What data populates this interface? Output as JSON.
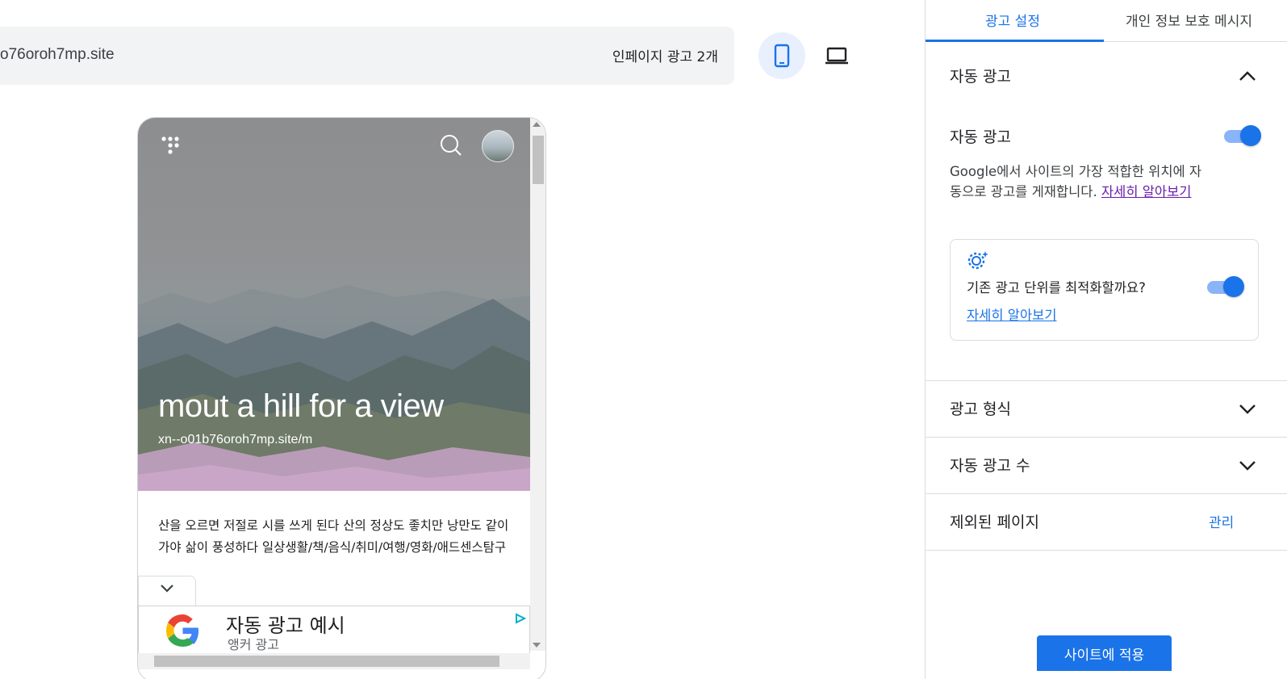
{
  "preview": {
    "url": "o76oroh7mp.site",
    "ad_count_label": "인페이지 광고 2개",
    "device_mobile_icon": "smartphone-icon",
    "device_desktop_icon": "laptop-icon"
  },
  "site": {
    "title": "mout a hill for a view",
    "subtitle": "xn--o01b76oroh7mp.site/m",
    "description": "산을 오르면 저절로 시를 쓰게 된다 산의 정상도 좋치만 낭만도 같이가야 삶이 풍성하다 일상생활/책/음식/취미/여행/영화/애드센스탐구",
    "menu_icon": "dots-menu-icon",
    "search_icon": "search-icon"
  },
  "anchor_ad": {
    "title": "자동 광고 예시",
    "subtitle": "앵커 광고"
  },
  "panel": {
    "tabs": [
      {
        "label": "광고 설정",
        "active": true
      },
      {
        "label": "개인 정보 보호 메시지",
        "active": false
      }
    ],
    "auto_ads": {
      "section_title": "자동 광고",
      "toggle_label": "자동 광고",
      "toggle_on": true,
      "info_text": "Google에서 사이트의 가장 적합한 위치에 자동으로 광고를 게재합니다.",
      "info_link": "자세히 알아보기",
      "card_text": "기존 광고 단위를 최적화할까요?",
      "card_toggle_on": true,
      "card_link": "자세히 알아보기"
    },
    "ad_formats": {
      "title": "광고 형식"
    },
    "ad_load": {
      "title": "자동 광고 수"
    },
    "excluded_pages": {
      "title": "제외된 페이지",
      "action": "관리"
    },
    "apply_button": "사이트에 적용"
  },
  "colors": {
    "accent": "#1a73e8",
    "toggle_track": "#8ab4f8",
    "visited_link": "#681da8"
  }
}
